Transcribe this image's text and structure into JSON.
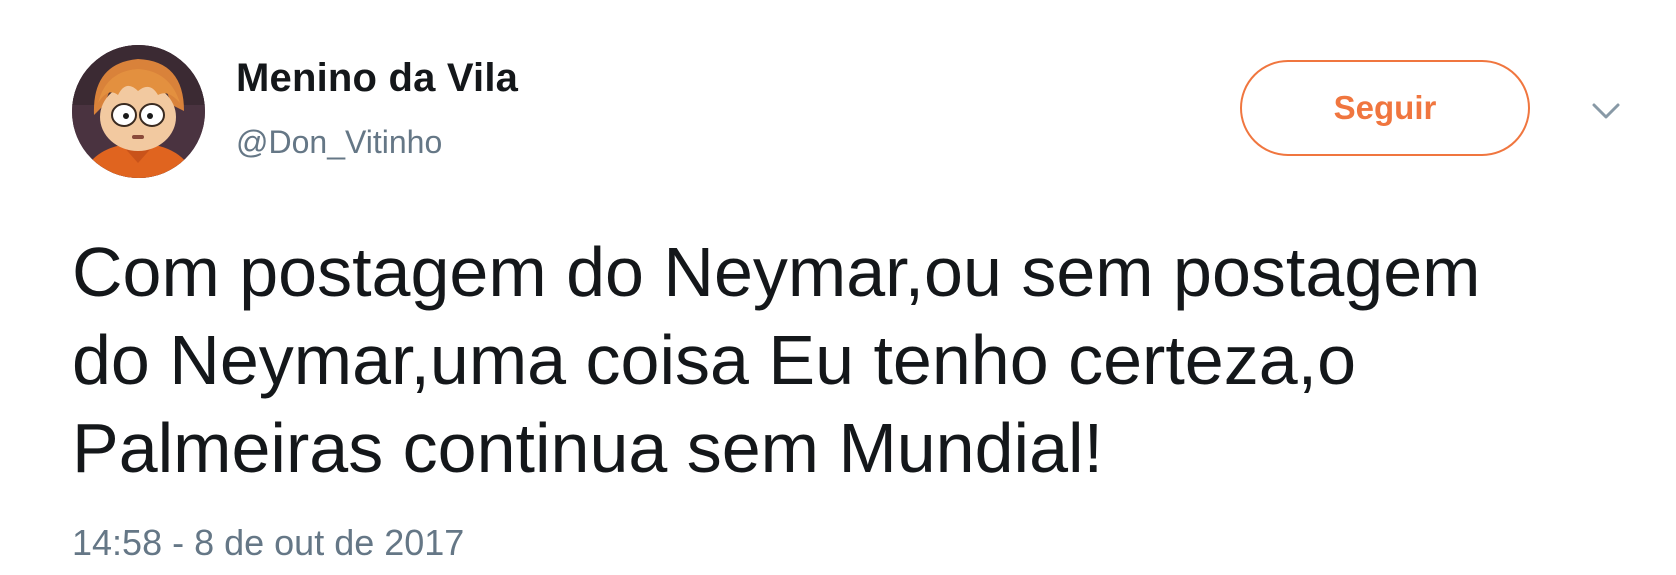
{
  "author": {
    "name": "Menino da Vila",
    "handle": "@Don_Vitinho",
    "avatar_icon": "cartoon-boy-avatar"
  },
  "actions": {
    "follow_label": "Seguir",
    "more_icon": "chevron-down-icon"
  },
  "tweet": {
    "lines": [
      "Com postagem do Neymar,ou sem postagem",
      "do Neymar,uma coisa Eu tenho certeza,o",
      "Palmeiras continua sem Mundial!"
    ],
    "timestamp": "14:58 - 8 de out de 2017"
  },
  "colors": {
    "accent": "#f0763f",
    "text": "#14171a",
    "muted": "#657786",
    "background": "#ffffff"
  }
}
